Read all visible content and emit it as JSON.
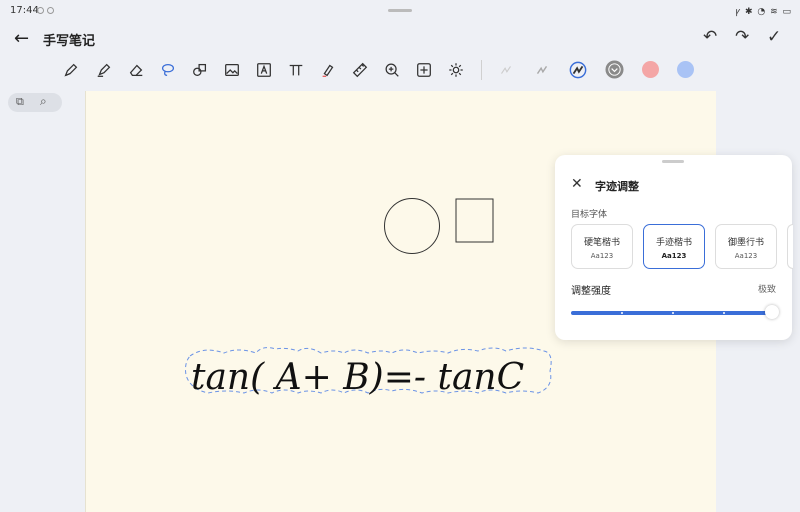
{
  "status": {
    "time": "17:44",
    "icons": "ꝩ ✱ ◔ ≋ ▭"
  },
  "header": {
    "title": "手写笔记"
  },
  "colors": {
    "canvas": "#fdf9ea",
    "accent": "#3a6ed8",
    "swatch_gray": "#8a8a8a",
    "swatch_pink": "#f4a6a6",
    "swatch_blue": "#a9c3f5"
  },
  "toolbar": {
    "tools": [
      "pen-icon",
      "highlighter-icon",
      "eraser-icon",
      "lasso-icon",
      "shapes-icon",
      "image-icon",
      "text-box-icon",
      "formula-icon",
      "marker-icon",
      "ruler-icon",
      "zoom-in-icon",
      "add-icon",
      "settings-icon"
    ]
  },
  "canvas": {
    "handwriting_text": "tan( A+ B)=- tanC"
  },
  "panel": {
    "title": "字迹调整",
    "subtitle": "目标字体",
    "fonts": [
      {
        "name": "硬笔楷书",
        "sample": "Aa123"
      },
      {
        "name": "手迹楷书",
        "sample": "Aa123"
      },
      {
        "name": "御墨行书",
        "sample": "Aa123"
      }
    ],
    "selected_font": "手迹楷书",
    "strength_label": "调整强度",
    "strength_value": "极致",
    "strength_level": 1.0
  }
}
